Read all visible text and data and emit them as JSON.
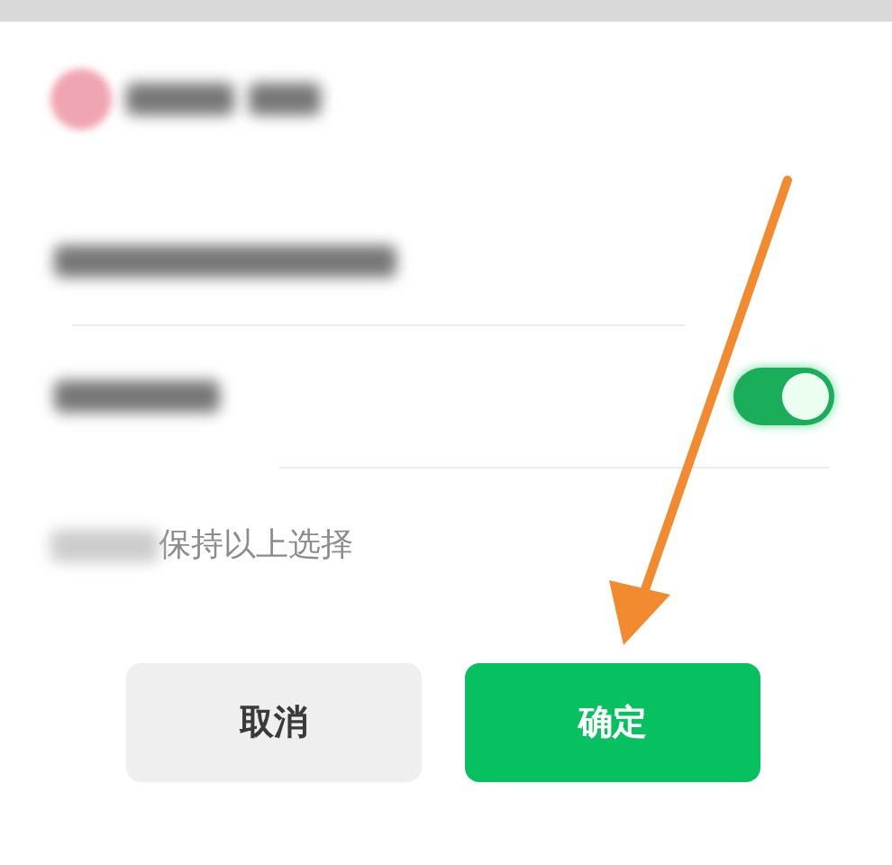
{
  "settings": [
    {
      "kind": "blurred"
    },
    {
      "kind": "switch",
      "on": true
    }
  ],
  "remember": {
    "label": "保持以上选择"
  },
  "buttons": [
    {
      "label": "取消",
      "kind": "secondary"
    },
    {
      "label": "确定",
      "kind": "primary"
    }
  ],
  "annotation": {
    "kind": "arrow",
    "color": "#f28a30"
  }
}
